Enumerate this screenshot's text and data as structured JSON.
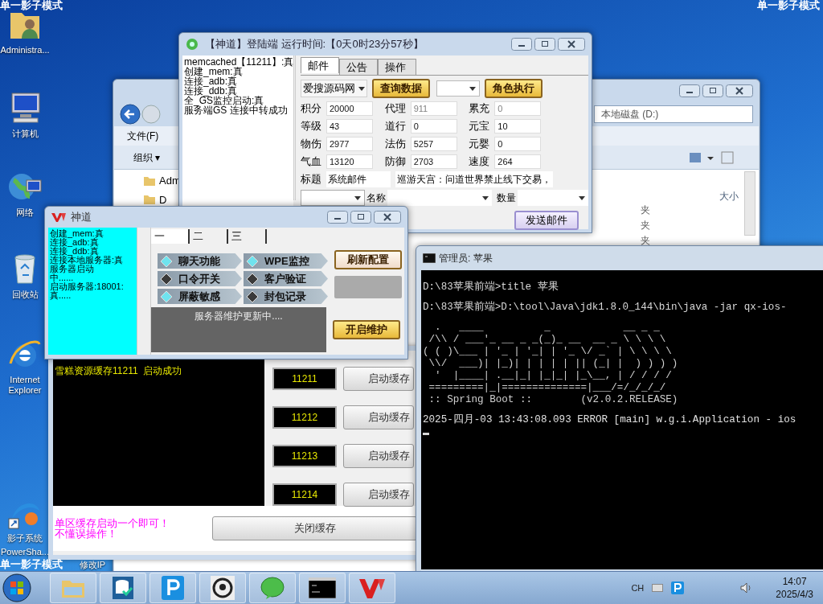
{
  "desktop": {
    "mode_labels": [
      "单一影子模式",
      "单一影子模式",
      "单一影子模式"
    ],
    "icons": [
      {
        "label": "Administra...",
        "kind": "user"
      },
      {
        "label": "计算机",
        "kind": "computer"
      },
      {
        "label": "网络",
        "kind": "network"
      },
      {
        "label": "回收站",
        "kind": "bin"
      },
      {
        "label": "Internet Explorer",
        "kind": "ie"
      },
      {
        "label": "影子系统",
        "kind": "shadow"
      },
      {
        "label": "PowerSha...",
        "kind": "none"
      },
      {
        "label": "修改IP",
        "kind": "none"
      }
    ]
  },
  "explorer": {
    "address": "本地磁盘 (D:)",
    "menu": "文件(F)",
    "organize": "组织 ▾",
    "tree": [
      "Adm",
      "D"
    ],
    "column": "大小",
    "rows": [
      "夹",
      "夹",
      "夹"
    ]
  },
  "login_window": {
    "title": "【神道】登陆端  运行时间:【0天0时23分57秒】",
    "log": [
      "memcached【11211】:真",
      "创建_mem:真",
      "连接_adb:真",
      "连接_ddb:真",
      "全_GS监控启动:真",
      "服务端GS  连接中转成功"
    ],
    "tabs": [
      {
        "label": "邮件",
        "selected": true
      },
      {
        "label": "公告",
        "selected": false
      },
      {
        "label": "操作",
        "selected": false
      }
    ],
    "server_combo": "爱搜源码网",
    "query_button": "查询数据",
    "role_button": "角色执行",
    "stats": [
      {
        "label": "积分",
        "value": "20000",
        "disabled": false
      },
      {
        "label": "代理",
        "value": "911",
        "disabled": true
      },
      {
        "label": "累充",
        "value": "0",
        "disabled": true
      },
      {
        "label": "等级",
        "value": "43",
        "disabled": false
      },
      {
        "label": "道行",
        "value": "0",
        "disabled": false
      },
      {
        "label": "元宝",
        "value": "10",
        "disabled": false
      },
      {
        "label": "物伤",
        "value": "2977",
        "disabled": false
      },
      {
        "label": "法伤",
        "value": "5257",
        "disabled": false
      },
      {
        "label": "元婴",
        "value": "0",
        "disabled": false
      },
      {
        "label": "气血",
        "value": "13120",
        "disabled": false
      },
      {
        "label": "防御",
        "value": "2703",
        "disabled": false
      },
      {
        "label": "速度",
        "value": "264",
        "disabled": false
      }
    ],
    "subject_label": "标题",
    "subject": "系统邮件",
    "message": "巡游天宫：问道世界禁止线下交易，",
    "name_label": "名称",
    "count_label": "数量",
    "send_button": "发送邮件"
  },
  "control_window": {
    "title": "神道",
    "log": [
      "创建_mem:真",
      "连接_adb:真",
      "连接_ddb:真",
      "连接本地服务器:真",
      "服务器启动",
      "中......",
      "启动服务器:18001:",
      "真....."
    ],
    "tabs": [
      {
        "label": "一",
        "selected": true
      },
      {
        "label": "二",
        "selected": false
      },
      {
        "label": "三",
        "selected": false
      }
    ],
    "toggles": [
      {
        "label": "聊天功能",
        "on": true
      },
      {
        "label": "WPE监控",
        "on": true
      },
      {
        "label": "口令开关",
        "on": false
      },
      {
        "label": "客户验证",
        "on": false
      },
      {
        "label": "屏蔽敏感",
        "on": true
      },
      {
        "label": "封包记录",
        "on": false
      }
    ],
    "refresh_button": "刷新配置",
    "status": "服务器维护更新中....",
    "maintain_button": "开启维护"
  },
  "cache_window": {
    "log": [
      "雪糕资源缓存11211  启动成功"
    ],
    "ports": [
      {
        "port": "11211",
        "button": "启动缓存"
      },
      {
        "port": "11212",
        "button": "启动缓存"
      },
      {
        "port": "11213",
        "button": "启动缓存"
      },
      {
        "port": "11214",
        "button": "启动缓存"
      }
    ],
    "notes": [
      "单区缓存启动一个即可！",
      "不懂误操作！"
    ],
    "close_button": "关闭缓存"
  },
  "console": {
    "title": "管理员: 苹果",
    "lines": [
      {
        "text": "D:\\83苹果前端>title 苹果",
        "kind": "prompt"
      },
      {
        "text": "D:\\83苹果前端>D:\\tool\\Java\\jdk1.8.0_144\\bin\\java -jar qx-ios-",
        "kind": "prompt"
      },
      {
        "text": "  .   ____          _            __ _ _",
        "kind": "art"
      },
      {
        "text": " /\\\\ / ___'_ __ _ _(_)_ __  __ _ \\ \\ \\ \\",
        "kind": "art"
      },
      {
        "text": "( ( )\\___ | '_ | '_| | '_ \\/ _` | \\ \\ \\ \\",
        "kind": "art"
      },
      {
        "text": " \\\\/  ___)| |_)| | | | | || (_| |  ) ) ) )",
        "kind": "art"
      },
      {
        "text": "  '  |____| .__|_| |_|_| |_\\__, | / / / /",
        "kind": "art"
      },
      {
        "text": " =========|_|==============|___/=/_/_/_/",
        "kind": "art"
      },
      {
        "text": " :: Spring Boot ::        (v2.0.2.RELEASE)",
        "kind": "art"
      },
      {
        "text": "2025-四月-03 13:43:08.093 ERROR [main] w.g.i.Application - ios",
        "kind": "log"
      }
    ]
  },
  "taskbar": {
    "apps": [
      {
        "kind": "folder"
      },
      {
        "kind": "database"
      },
      {
        "kind": "p"
      },
      {
        "kind": "ink"
      },
      {
        "kind": "chat"
      },
      {
        "kind": "cmd"
      },
      {
        "kind": "v"
      }
    ],
    "language": "CH",
    "clock_time": "14:07",
    "clock_date": "2025/4/3"
  }
}
